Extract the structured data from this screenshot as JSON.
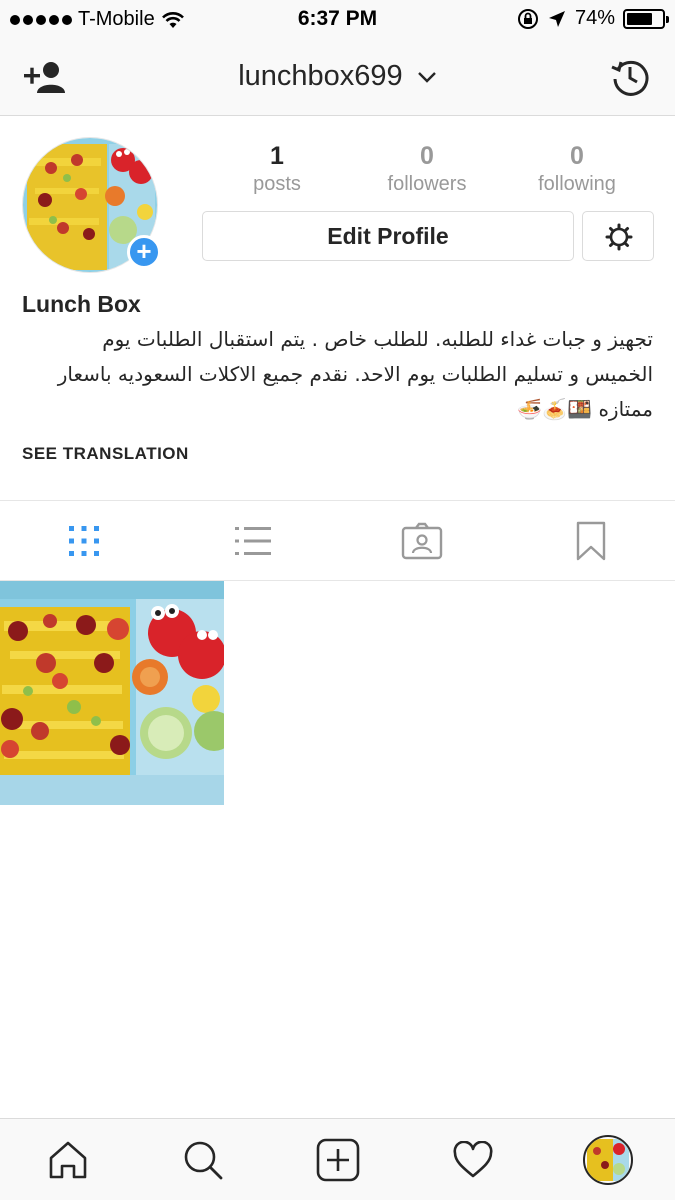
{
  "status_bar": {
    "carrier": "T-Mobile",
    "time": "6:37 PM",
    "battery_percent": "74%",
    "battery_level": 0.74,
    "icons": [
      "signal-dots-icon",
      "wifi-icon",
      "orientation-lock-icon",
      "location-arrow-icon",
      "battery-icon"
    ]
  },
  "header": {
    "username": "lunchbox699",
    "icons": [
      "add-user-icon",
      "chevron-down-icon",
      "history-icon"
    ]
  },
  "profile": {
    "stats": [
      {
        "count": "1",
        "label": "posts"
      },
      {
        "count": "0",
        "label": "followers"
      },
      {
        "count": "0",
        "label": "following"
      }
    ],
    "edit_profile_label": "Edit Profile",
    "name": "Lunch Box",
    "bio_line1": "تجهيز و جبات غداء للطلبه. للطلب خاص . يتم استقبال الطلبات يوم",
    "bio_line2": "الخميس و تسليم الطلبات يوم الاحد. نقدم جميع الاكلات السعوديه باسعار",
    "bio_line3": "ممتازه 🍱🍝🍜",
    "see_translation": "SEE TRANSLATION"
  },
  "tabs": {
    "items": [
      "grid-icon",
      "list-icon",
      "tagged-icon",
      "saved-bookmark-icon"
    ],
    "active_color": "#3897f0"
  },
  "bottom_nav": {
    "items": [
      "home-icon",
      "search-icon",
      "new-post-icon",
      "activity-heart-icon",
      "profile-avatar"
    ]
  },
  "colors": {
    "accent": "#3897f0",
    "text": "#262626",
    "muted": "#999999",
    "border": "#dbdbdb"
  }
}
